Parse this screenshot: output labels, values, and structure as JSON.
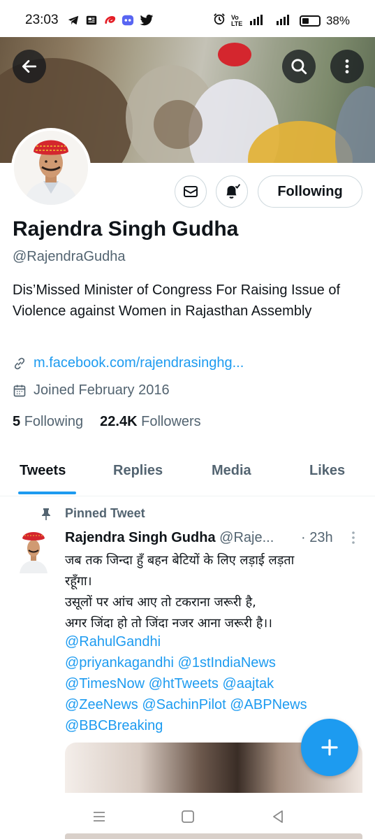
{
  "status_bar": {
    "time": "23:03",
    "network_label": "Vo LTE",
    "battery": "38%",
    "app_icons": [
      "telegram-icon",
      "news-icon",
      "airtel-icon",
      "discord-icon",
      "twitter-icon"
    ]
  },
  "profile": {
    "name": "Rajendra Singh Gudha",
    "handle": "@RajendraGudha",
    "bio": "Dis’Missed Minister of Congress For Raising Issue of Violence against Women in Rajasthan Assembly",
    "link": "m.facebook.com/rajendrasinghg...",
    "joined": "Joined February 2016",
    "following_count": "5",
    "following_label": "Following",
    "followers_count": "22.4K",
    "followers_label": "Followers",
    "follow_button_label": "Following"
  },
  "tabs": [
    {
      "label": "Tweets",
      "active": true
    },
    {
      "label": "Replies",
      "active": false
    },
    {
      "label": "Media",
      "active": false
    },
    {
      "label": "Likes",
      "active": false
    }
  ],
  "pinned_tweet": {
    "pinned_label": "Pinned Tweet",
    "author_name": "Rajendra Singh Gudha",
    "author_handle": "@Raje...",
    "time": "· 23h",
    "text_lines": [
      "जब तक जिन्दा हुँ बहन बेटियों के लिए लड़ाई लड़ता",
      "रहूँगा।",
      "उसूलों पर आंच आए तो टकराना जरूरी है,",
      "अगर जिंदा हो तो जिंदा नजर आना जरूरी है।।"
    ],
    "mention_lines": [
      "@RahulGandhi",
      "@priyankagandhi @1stIndiaNews",
      "@TimesNow @htTweets @aajtak",
      "@ZeeNews @SachinPilot @ABPNews",
      "@BBCBreaking"
    ]
  },
  "colors": {
    "accent": "#1d9bf0",
    "text_primary": "#0f1419",
    "text_secondary": "#536471",
    "border": "#cfd9de",
    "turban_red": "#d4262e"
  }
}
